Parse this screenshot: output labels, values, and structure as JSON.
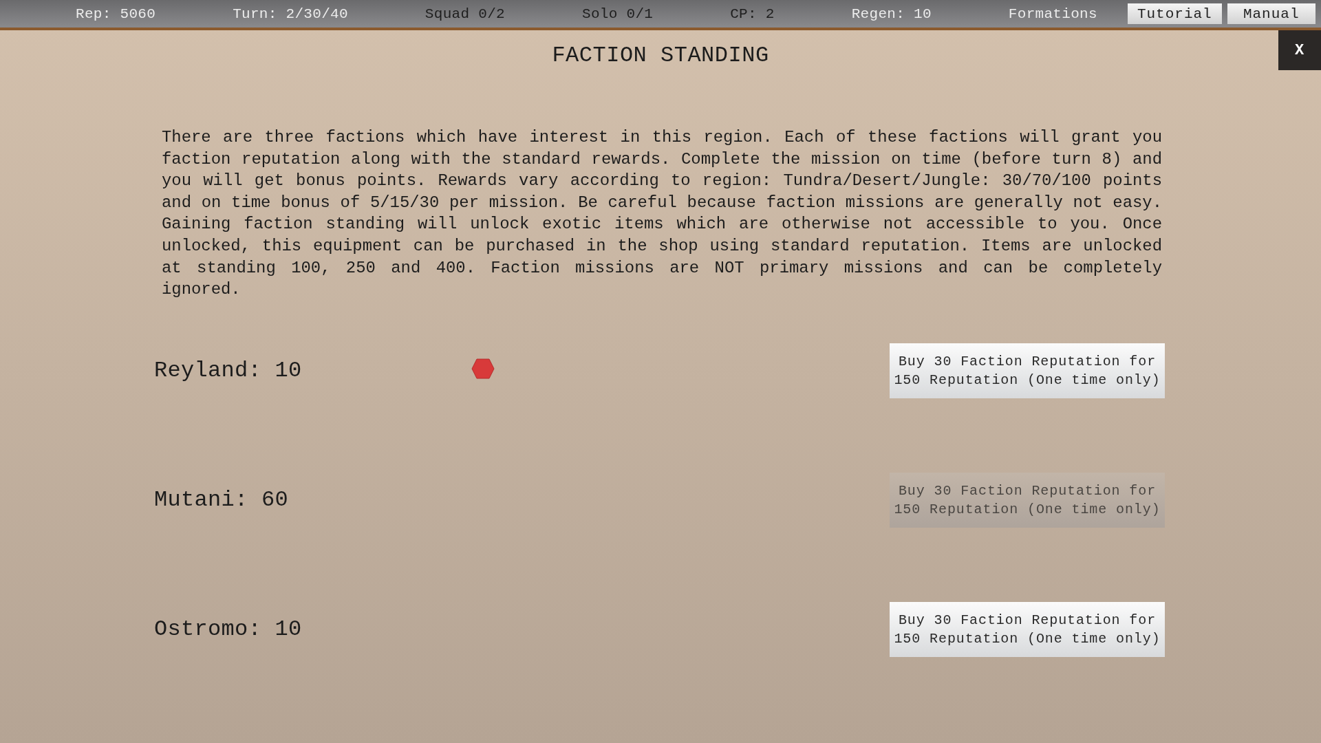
{
  "top_bar": {
    "stats": [
      {
        "text": "Rep: 5060",
        "kind": "light"
      },
      {
        "text": "Turn: 2/30/40",
        "kind": "light"
      },
      {
        "text": "Squad 0/2",
        "kind": "dark"
      },
      {
        "text": "Solo 0/1",
        "kind": "dark"
      },
      {
        "text": "CP: 2",
        "kind": "dark"
      },
      {
        "text": "Regen: 10",
        "kind": "light"
      },
      {
        "text": "Formations",
        "kind": "light"
      }
    ],
    "buttons": [
      "Tutorial",
      "Manual"
    ]
  },
  "dialog": {
    "title": "FACTION STANDING",
    "close": "X",
    "description": "There are three factions which have interest in this region. Each of these factions will grant you faction reputation along with the standard rewards. Complete the mission on time (before turn 8) and you will get bonus points. Rewards vary according to region: Tundra/Desert/Jungle: 30/70/100 points and on time bonus of 5/15/30 per mission. Be careful because faction missions are generally not easy. Gaining faction standing will unlock exotic items which are otherwise not accessible to you. Once unlocked, this equipment can be purchased in the shop using standard reputation. Items are unlocked at standing 100, 250 and 400. Faction missions are NOT primary missions and can be completely ignored.",
    "factions": [
      {
        "label": "Reyland: 10",
        "button": "Buy 30 Faction Reputation for 150 Reputation (One time only)",
        "disabled": false
      },
      {
        "label": "Mutani: 60",
        "button": "Buy 30 Faction Reputation for 150 Reputation (One time only)",
        "disabled": true
      },
      {
        "label": "Ostromo: 10",
        "button": "Buy 30 Faction Reputation for 150 Reputation (One time only)",
        "disabled": false
      }
    ]
  }
}
